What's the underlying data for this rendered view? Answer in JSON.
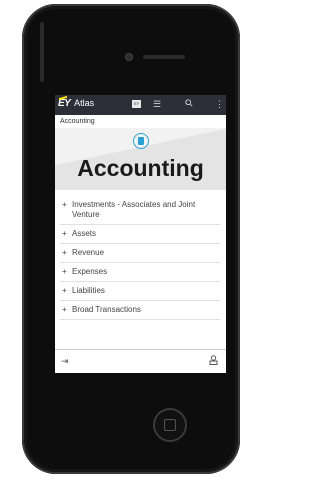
{
  "app": {
    "brand": "EY",
    "name": "Atlas",
    "badge": "EY"
  },
  "breadcrumb": "Accounting",
  "page_title": "Accounting",
  "topics": [
    "Investments - Associates and Joint Venture",
    "Assets",
    "Revenue",
    "Expenses",
    "Liabilities",
    "Broad Transactions"
  ],
  "icons": {
    "menu": "list-icon",
    "search": "search-icon",
    "more": "more-vertical-icon",
    "signin": "sign-in-icon",
    "user": "user-icon"
  },
  "colors": {
    "topbar": "#2e2e38",
    "accent": "#2a9fd6",
    "brand_yellow": "#ffe600"
  }
}
